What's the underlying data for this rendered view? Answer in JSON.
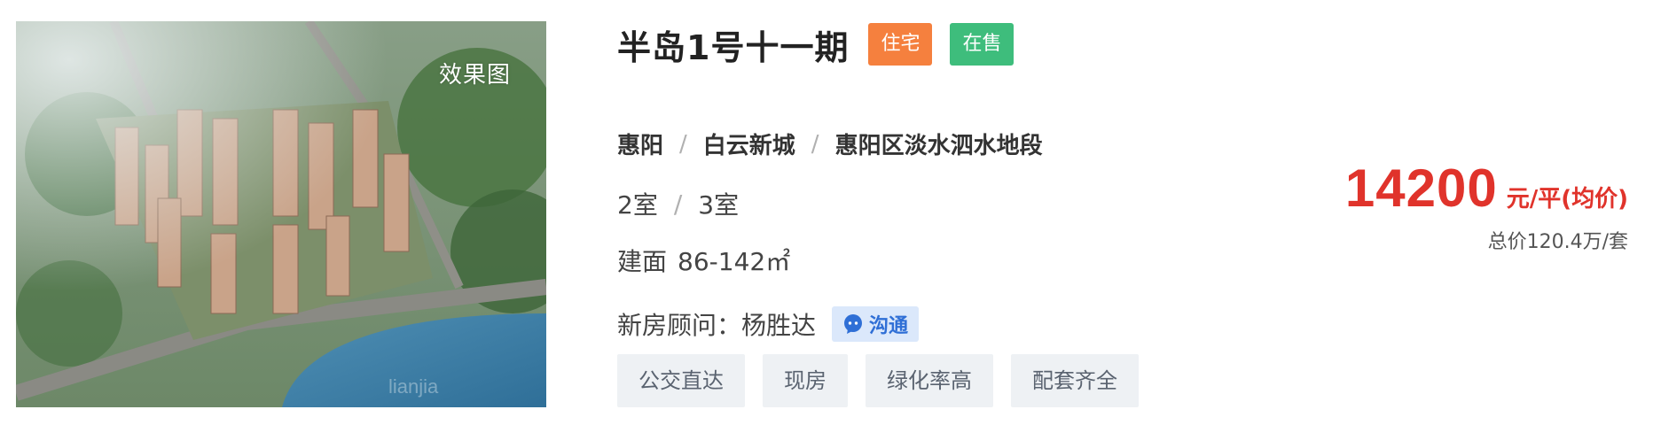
{
  "image": {
    "tag": "效果图",
    "watermark": "lianjia"
  },
  "project": {
    "name": "半岛1号十一期",
    "badge_type": "住宅",
    "badge_status": "在售",
    "colors": {
      "badge_type": "#f5803e",
      "badge_status": "#3ebd7c",
      "price": "#e0332b",
      "chat_bg": "#dbe8fb",
      "chat_text": "#2f6fd6"
    }
  },
  "location": {
    "city": "惠阳",
    "district": "白云新城",
    "address": "惠阳区淡水泗水地段"
  },
  "rooms": {
    "a": "2室",
    "b": "3室"
  },
  "area": {
    "label": "建面",
    "value": "86-142㎡"
  },
  "advisor": {
    "label": "新房顾问：",
    "name": "杨胜达",
    "chat_label": "沟通",
    "chat_icon": "chat-bubble-icon"
  },
  "tags": [
    "公交直达",
    "现房",
    "绿化率高",
    "配套齐全"
  ],
  "price": {
    "value": "14200",
    "unit": "元/平(均价)",
    "total": "总价120.4万/套"
  }
}
